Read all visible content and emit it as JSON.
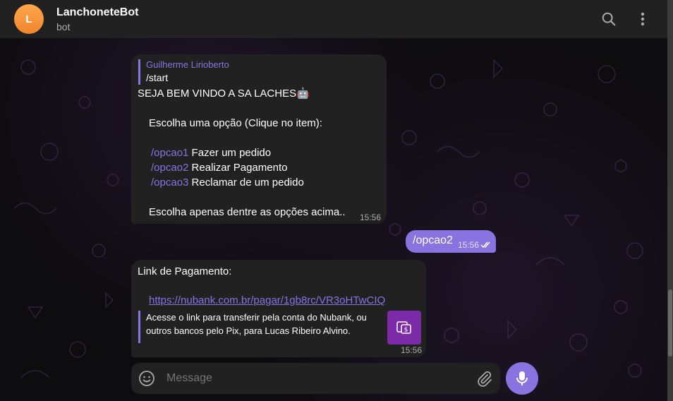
{
  "header": {
    "avatar_letter": "L",
    "title": "LanchoneteBot",
    "subtitle": "bot",
    "avatar_color": "#f5913a",
    "icons": [
      "search-icon",
      "more-vertical-icon"
    ]
  },
  "messages": [
    {
      "direction": "incoming",
      "reply": {
        "name": "Guilherme Lirioberto",
        "text": "/start"
      },
      "lines": {
        "welcome": "SEJA BEM VINDO A SA LACHES🤖",
        "prompt": "Escolha uma opção (Clique no item):",
        "opt1_cmd": "/opcao1",
        "opt1_text": " Fazer um pedido",
        "opt2_cmd": "/opcao2",
        "opt2_text": " Realizar Pagamento",
        "opt3_cmd": "/opcao3",
        "opt3_text": " Reclamar de um pedido",
        "footer": "Escolha apenas dentre as opções acima.."
      },
      "time": "15:56"
    },
    {
      "direction": "outgoing",
      "text": "/opcao2",
      "time": "15:56",
      "status": "read"
    },
    {
      "direction": "incoming",
      "title": "Link de Pagamento:",
      "link": "https://nubank.com.br/pagar/1gb8rc/VR3oHTwCIQ",
      "preview_text": "Acesse o link para transferir pela conta do Nubank, ou outros bancos pelo Pix, para Lucas Ribeiro Alvino.",
      "time": "15:56"
    }
  ],
  "composer": {
    "placeholder": "Message"
  },
  "colors": {
    "accent": "#8774e1",
    "bubble_in": "#212121",
    "header_bg": "#212121",
    "preview_thumb": "#7b2aa8"
  }
}
